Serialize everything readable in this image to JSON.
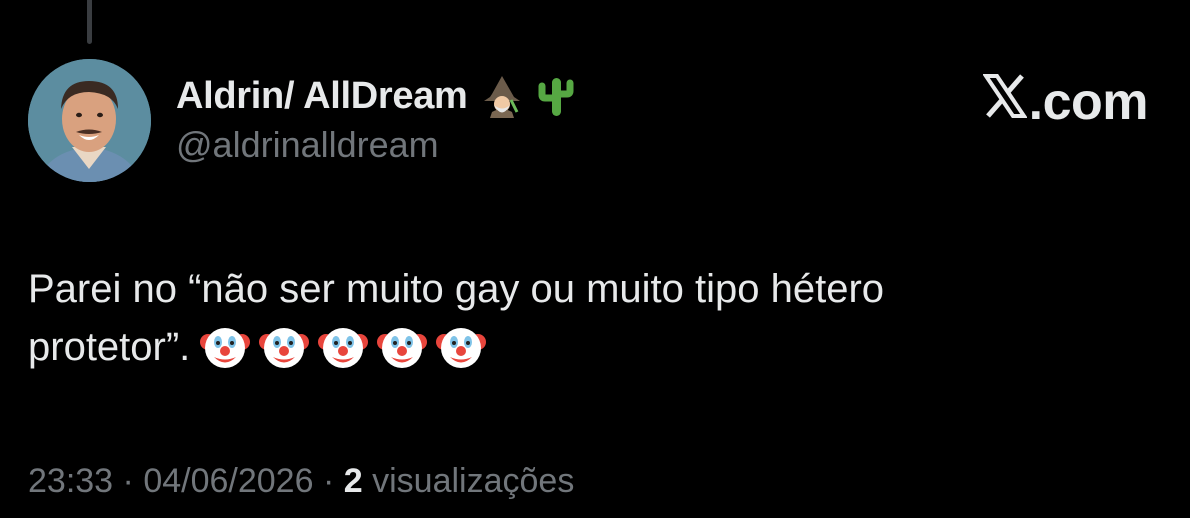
{
  "user": {
    "display_name": "Aldrin/ AllDream",
    "name_emojis": [
      "mage-icon",
      "cactus-icon"
    ],
    "handle": "@aldrinalldream",
    "avatar": "avatar"
  },
  "brand": {
    "label": ".com",
    "logo": "x-logo-icon"
  },
  "tweet": {
    "text_line1": "Parei no “não ser muito gay ou muito tipo hétero",
    "text_line2": "protetor”.",
    "emojis": [
      "clown-face-icon",
      "clown-face-icon",
      "clown-face-icon",
      "clown-face-icon",
      "clown-face-icon"
    ]
  },
  "meta": {
    "time": "23:33",
    "separator": "·",
    "date": "04/06/2026",
    "views_count": "2",
    "views_label": "visualizações"
  },
  "colors": {
    "background": "#000000",
    "primary_text": "#e7e9ea",
    "secondary_text": "#71767b"
  }
}
